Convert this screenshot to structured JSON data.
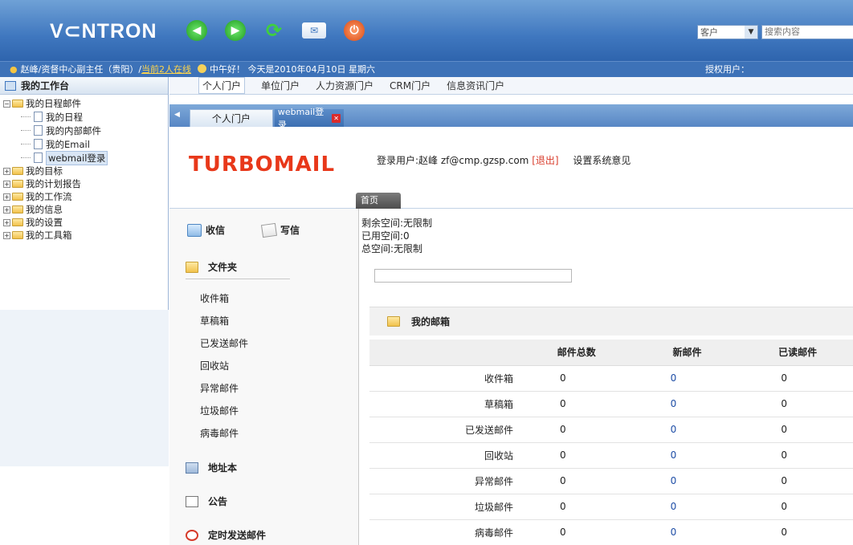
{
  "app": {
    "logo": "V⊂NTRON",
    "scope_select": "客户",
    "search_placeholder": "搜索内容"
  },
  "status": {
    "user_dept": "赵峰/资督中心副主任（贵阳）/",
    "online": "当前2人在线",
    "greeting": "中午好！ 今天是2010年04月10日 星期六",
    "auth_user": "授权用户："
  },
  "leftnav": {
    "title": "我的工作台",
    "tree": [
      {
        "label": "我的日程邮件",
        "expanded": true,
        "children": [
          "我的日程",
          "我的内部邮件",
          "我的Email",
          "webmail登录"
        ]
      },
      {
        "label": "我的目标"
      },
      {
        "label": "我的计划报告"
      },
      {
        "label": "我的工作流"
      },
      {
        "label": "我的信息"
      },
      {
        "label": "我的设置"
      },
      {
        "label": "我的工具箱"
      }
    ],
    "selected_child": "webmail登录"
  },
  "portal_tabs": [
    "个人门户",
    "单位门户",
    "人力资源门户",
    "CRM门户",
    "信息资讯门户"
  ],
  "window_tabs": {
    "home": "个人门户",
    "webmail": "webmail登录"
  },
  "turbomail": {
    "logo": "TURBOMAIL",
    "user_prefix": "登录用户:赵峰",
    "email": "zf@cmp.gzsp.com",
    "logout": "[退出]",
    "settings": "设置系统意见",
    "home_tab": "首页"
  },
  "mail_left": {
    "receive": "收信",
    "write": "写信",
    "folders_title": "文件夹",
    "folders": [
      "收件箱",
      "草稿箱",
      "已发送邮件",
      "回收站",
      "异常邮件",
      "垃圾邮件",
      "病毒邮件"
    ],
    "address_book": "地址本",
    "notice": "公告",
    "scheduled": "定时发送邮件"
  },
  "space": {
    "remaining": "剩余空间:无限制",
    "used": "已用空间:0",
    "total": "总空间:无限制"
  },
  "mailbox": {
    "title": "我的邮箱",
    "columns": [
      "",
      "邮件总数",
      "新邮件",
      "已读邮件"
    ],
    "rows": [
      {
        "name": "收件箱",
        "total": "0",
        "new": "0",
        "read": "0"
      },
      {
        "name": "草稿箱",
        "total": "0",
        "new": "0",
        "read": "0"
      },
      {
        "name": "已发送邮件",
        "total": "0",
        "new": "0",
        "read": "0"
      },
      {
        "name": "回收站",
        "total": "0",
        "new": "0",
        "read": "0"
      },
      {
        "name": "异常邮件",
        "total": "0",
        "new": "0",
        "read": "0"
      },
      {
        "name": "垃圾邮件",
        "total": "0",
        "new": "0",
        "read": "0"
      },
      {
        "name": "病毒邮件",
        "total": "0",
        "new": "0",
        "read": "0"
      }
    ]
  },
  "colors": {
    "topbar": "#3f77bf",
    "turbomail_logo": "#e8381a",
    "logout": "#d83b2a"
  }
}
